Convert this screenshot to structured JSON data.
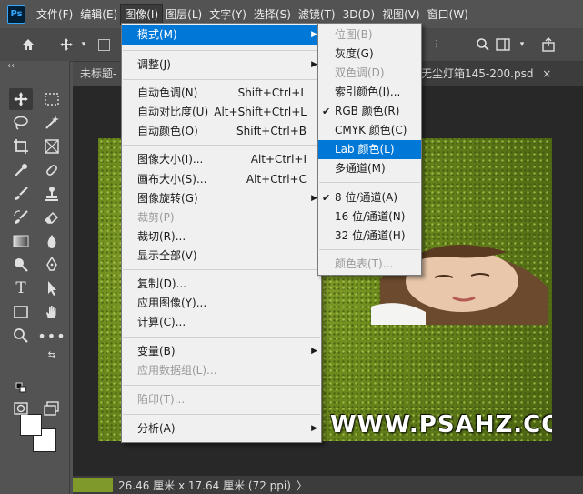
{
  "app": {
    "logo": "Ps"
  },
  "menubar": {
    "items": [
      "文件(F)",
      "编辑(E)",
      "图像(I)",
      "图层(L)",
      "文字(Y)",
      "选择(S)",
      "滤镜(T)",
      "3D(D)",
      "视图(V)",
      "窗口(W)"
    ]
  },
  "tabs": {
    "untitled": "未标题-",
    "doc": "无尘灯箱145-200.psd",
    "close": "×"
  },
  "toolbox": {
    "collapse": "‹‹"
  },
  "image_menu": {
    "mode": "模式(M)",
    "adjust": "调整(J)",
    "auto_tone": "自动色调(N)",
    "auto_tone_sc": "Shift+Ctrl+L",
    "auto_contrast": "自动对比度(U)",
    "auto_contrast_sc": "Alt+Shift+Ctrl+L",
    "auto_color": "自动颜色(O)",
    "auto_color_sc": "Shift+Ctrl+B",
    "image_size": "图像大小(I)...",
    "image_size_sc": "Alt+Ctrl+I",
    "canvas_size": "画布大小(S)...",
    "canvas_size_sc": "Alt+Ctrl+C",
    "rotation": "图像旋转(G)",
    "crop": "裁剪(P)",
    "trim": "裁切(R)...",
    "reveal_all": "显示全部(V)",
    "duplicate": "复制(D)...",
    "apply_image": "应用图像(Y)...",
    "calculations": "计算(C)...",
    "variables": "变量(B)",
    "apply_dataset": "应用数据组(L)...",
    "trap": "陷印(T)...",
    "analysis": "分析(A)"
  },
  "mode_menu": {
    "bitmap": "位图(B)",
    "grayscale": "灰度(G)",
    "duotone": "双色调(D)",
    "indexed": "索引颜色(I)...",
    "rgb": "RGB 颜色(R)",
    "cmyk": "CMYK 颜色(C)",
    "lab": "Lab 颜色(L)",
    "multichannel": "多通道(M)",
    "bit8": "8 位/通道(A)",
    "bit16": "16 位/通道(N)",
    "bit32": "32 位/通道(H)",
    "color_table": "颜色表(T)...",
    "check": "✔"
  },
  "watermark": "WWW.PSAHZ.COM",
  "status": {
    "size": "26.46 厘米 x 17.64 厘米 (72 ppi)",
    "arrow": "〉"
  }
}
